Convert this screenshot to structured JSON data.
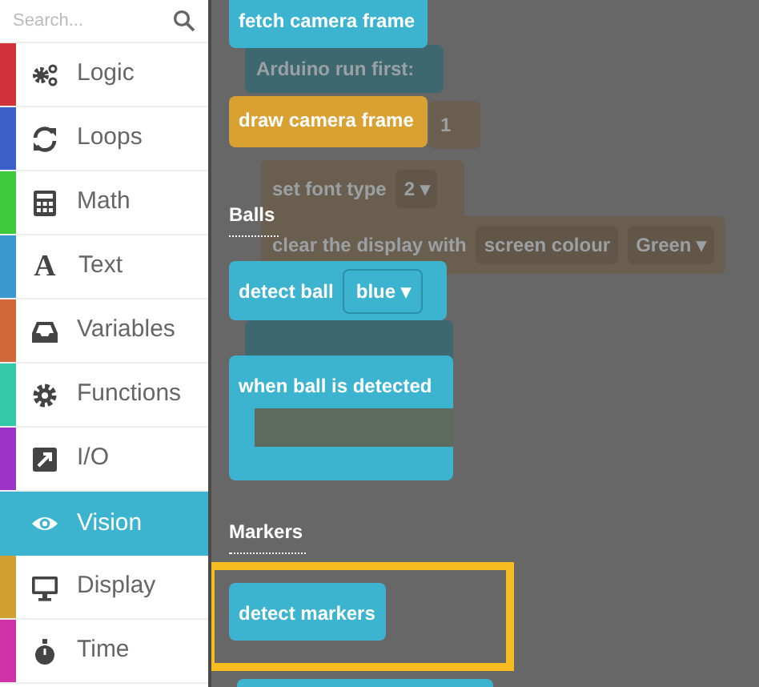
{
  "search": {
    "placeholder": "Search..."
  },
  "categories": [
    {
      "label": "Logic",
      "color": "#d0333a",
      "selected": false
    },
    {
      "label": "Loops",
      "color": "#3b5fc9",
      "selected": false
    },
    {
      "label": "Math",
      "color": "#3cc93c",
      "selected": false
    },
    {
      "label": "Text",
      "color": "#3a97d0",
      "selected": false,
      "glyph": "A"
    },
    {
      "label": "Variables",
      "color": "#d0683a",
      "selected": false
    },
    {
      "label": "Functions",
      "color": "#33c9a8",
      "selected": false
    },
    {
      "label": "I/O",
      "color": "#9d33c9",
      "selected": false
    },
    {
      "label": "Vision",
      "color": "#3cb4d0",
      "selected": true
    },
    {
      "label": "Display",
      "color": "#d0a033",
      "selected": false
    },
    {
      "label": "Time",
      "color": "#d033a8",
      "selected": false
    }
  ],
  "faded_blocks": [
    {
      "parts": [
        "Arduino run first:"
      ]
    },
    {
      "parts": [
        "1"
      ]
    },
    {
      "parts": [
        "set font type",
        "2 ▾"
      ]
    },
    {
      "parts": [
        "clear the display with",
        "screen colour",
        "Green ▾"
      ]
    }
  ],
  "flyout": [
    {
      "kind": "block",
      "text": "fetch camera frame",
      "color": "#3cb4d0"
    },
    {
      "kind": "block",
      "text": "draw camera frame",
      "color": "#d9a032"
    },
    {
      "kind": "label",
      "text": "Balls"
    },
    {
      "kind": "block",
      "text": "detect ball",
      "dropdown": "blue ▾",
      "color": "#3cb4d0"
    },
    {
      "kind": "c_block",
      "text": "when ball is detected",
      "color": "#3cb4d0"
    },
    {
      "kind": "label",
      "text": "Markers"
    },
    {
      "kind": "block",
      "text": "detect markers",
      "color": "#3cb4d0",
      "highlighted": true
    }
  ]
}
